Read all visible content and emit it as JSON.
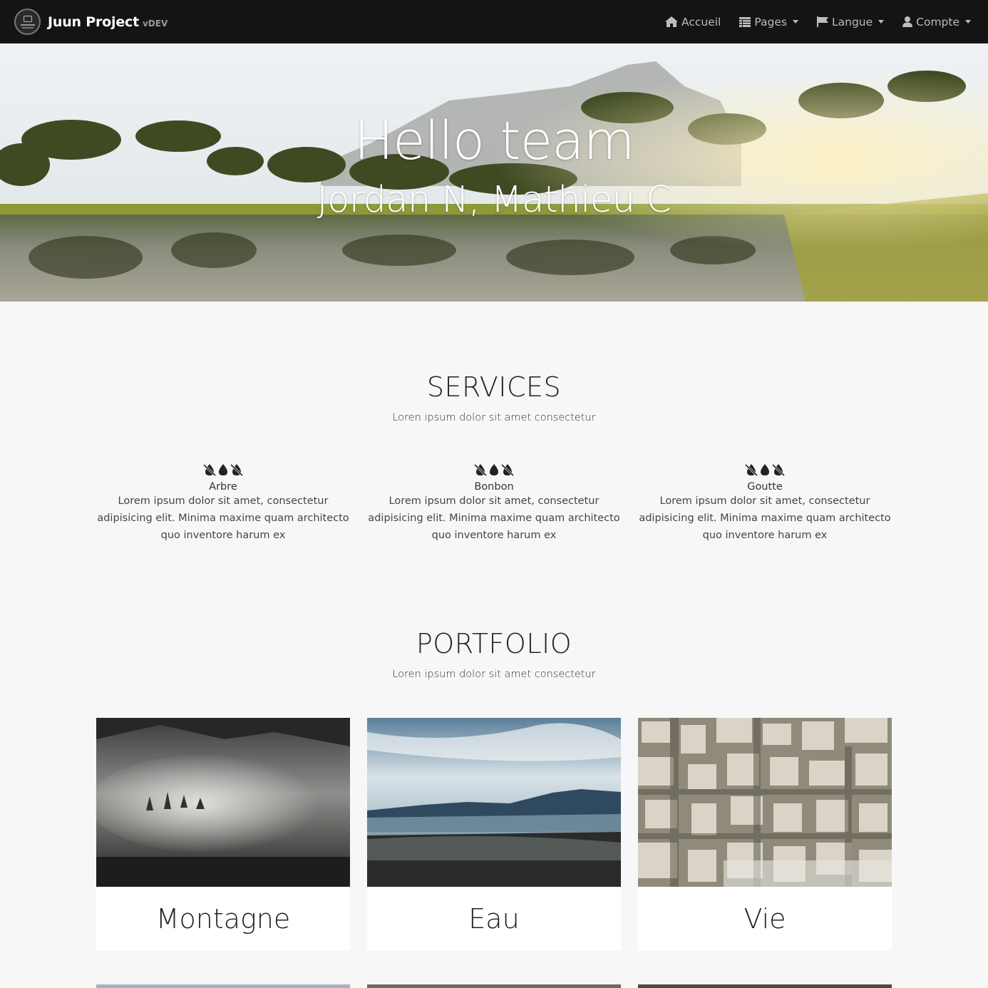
{
  "navbar": {
    "brand": "Juun Project",
    "version": "vDEV",
    "items": [
      {
        "label": "Accueil",
        "icon": "home-icon",
        "dropdown": false
      },
      {
        "label": "Pages",
        "icon": "table-icon",
        "dropdown": true
      },
      {
        "label": "Langue",
        "icon": "flag-icon",
        "dropdown": true
      },
      {
        "label": "Compte",
        "icon": "user-icon",
        "dropdown": true
      }
    ]
  },
  "hero": {
    "title": "Hello team",
    "subtitle": "Jordan N, Mathieu C"
  },
  "services": {
    "title": "SERVICES",
    "subtitle": "Loren ipsum dolor sit amet consectetur",
    "items": [
      {
        "name": "Arbre",
        "description": "Lorem ipsum dolor sit amet, consectetur adipisicing elit. Minima maxime quam architecto quo inventore harum ex",
        "icons": [
          "tint-slash-icon",
          "tint-icon",
          "tint-slash-icon"
        ]
      },
      {
        "name": "Bonbon",
        "description": "Lorem ipsum dolor sit amet, consectetur adipisicing elit. Minima maxime quam architecto quo inventore harum ex",
        "icons": [
          "tint-slash-icon",
          "tint-icon",
          "tint-slash-icon"
        ]
      },
      {
        "name": "Goutte",
        "description": "Lorem ipsum dolor sit amet, consectetur adipisicing elit. Minima maxime quam architecto quo inventore harum ex",
        "icons": [
          "tint-slash-icon",
          "tint-icon",
          "tint-slash-icon"
        ]
      }
    ]
  },
  "portfolio": {
    "title": "PORTFOLIO",
    "subtitle": "Loren ipsum dolor sit amet consectetur",
    "items": [
      {
        "label": "Montagne"
      },
      {
        "label": "Eau"
      },
      {
        "label": "Vie"
      }
    ]
  },
  "colors": {
    "navbar_bg": "#141414",
    "nav_text": "#bdbdbd",
    "page_bg": "#f7f7f7",
    "card_bg": "#ffffff"
  }
}
